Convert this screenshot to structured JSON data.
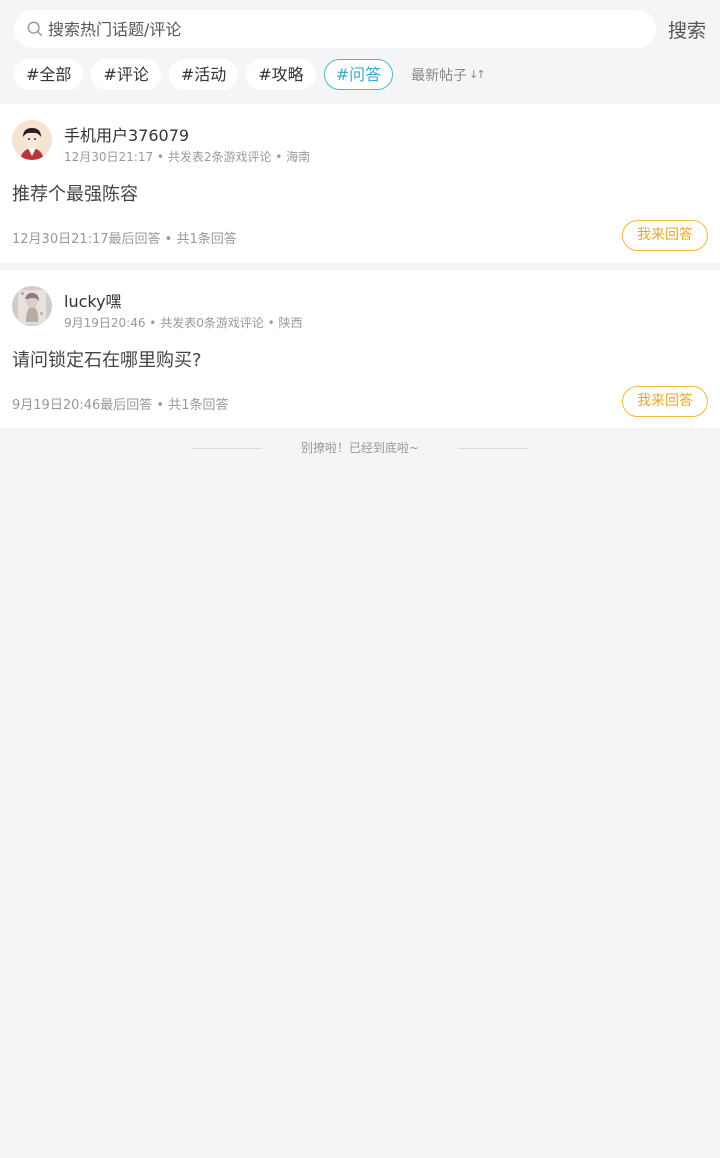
{
  "search": {
    "placeholder": "搜索热门话题/评论",
    "button_label": "搜索"
  },
  "tags": [
    {
      "label": "#全部",
      "active": false
    },
    {
      "label": "#评论",
      "active": false
    },
    {
      "label": "#活动",
      "active": false
    },
    {
      "label": "#攻略",
      "active": false
    },
    {
      "label": "#问答",
      "active": true
    }
  ],
  "sort": {
    "label": "最新帖子",
    "icon": "sort-arrows-icon"
  },
  "posts": [
    {
      "username": "手机用户376079",
      "meta": "12月30日21:17 • 共发表2条游戏评论 • 海南",
      "title": "推荐个最强陈容",
      "footer": "12月30日21:17最后回答 • 共1条回答",
      "answer_label": "我来回答"
    },
    {
      "username": "lucky嘿",
      "meta": "9月19日20:46 • 共发表0条游戏评论 • 陕西",
      "title": "请问锁定石在哪里购买?",
      "footer": "9月19日20:46最后回答 • 共1条回答",
      "answer_label": "我来回答"
    }
  ],
  "end_text": "别撩啦！已经到底啦~",
  "colors": {
    "accent_active_tag": "#3aaccb",
    "answer_button": "#eaa72a",
    "background": "#f4f5f7"
  }
}
